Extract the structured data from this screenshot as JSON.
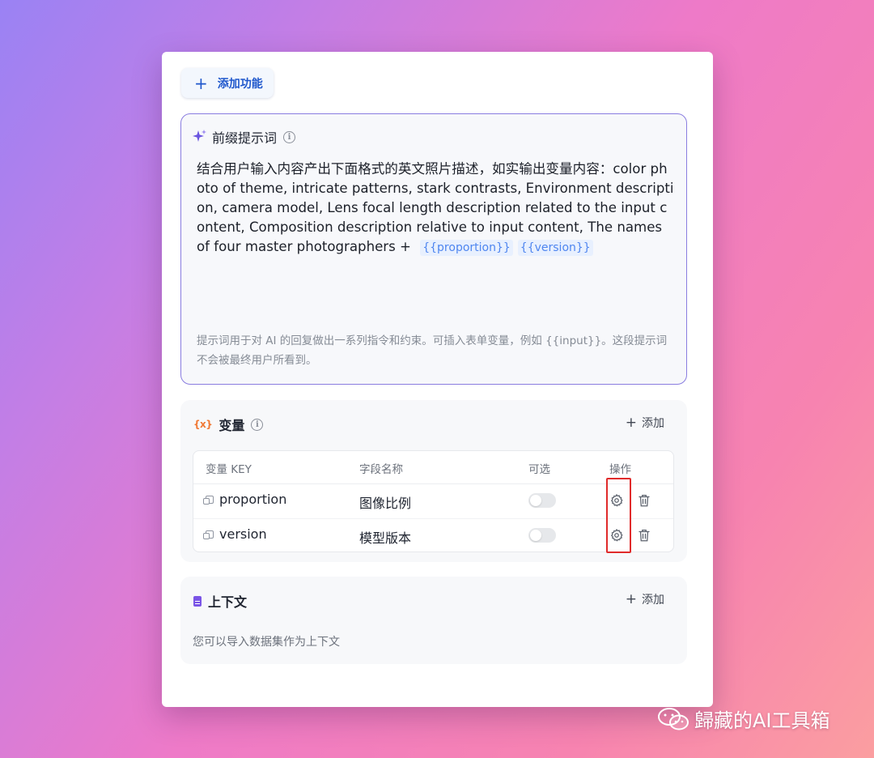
{
  "toolbar": {
    "add_feature_label": "添加功能"
  },
  "prompt": {
    "title": "前缀提示词",
    "text": "结合用户输入内容产出下面格式的英文照片描述，如实输出变量内容：color photo of theme, intricate patterns, stark contrasts, Environment description, camera model, Lens focal length description related to the input content, Composition description relative to input content, The names of four master photographers + ",
    "chips": [
      "{{proportion}}",
      "{{version}}"
    ],
    "hint": "提示词用于对 AI 的回复做出一系列指令和约束。可插入表单变量，例如 {{input}}。这段提示词不会被最终用户所看到。"
  },
  "variables": {
    "title": "变量",
    "icon_glyph": "{x}",
    "add_label": "添加",
    "columns": [
      "变量 KEY",
      "字段名称",
      "可选",
      "操作"
    ],
    "rows": [
      {
        "key": "proportion",
        "name": "图像比例",
        "optional": false
      },
      {
        "key": "version",
        "name": "模型版本",
        "optional": false
      }
    ]
  },
  "context": {
    "title": "上下文",
    "add_label": "添加",
    "hint": "您可以导入数据集作为上下文"
  },
  "watermark": {
    "text": "歸藏的AI工具箱"
  },
  "colors": {
    "accent_blue": "#1f57cc",
    "prompt_border": "#8a7de0",
    "highlight_red": "#e02b2b",
    "var_icon_orange": "#f07833"
  },
  "icons": [
    "plus-icon",
    "sparkle-icon",
    "info-icon",
    "variable-icon",
    "key-icon",
    "gear-icon",
    "trash-icon",
    "document-icon",
    "wechat-icon"
  ]
}
